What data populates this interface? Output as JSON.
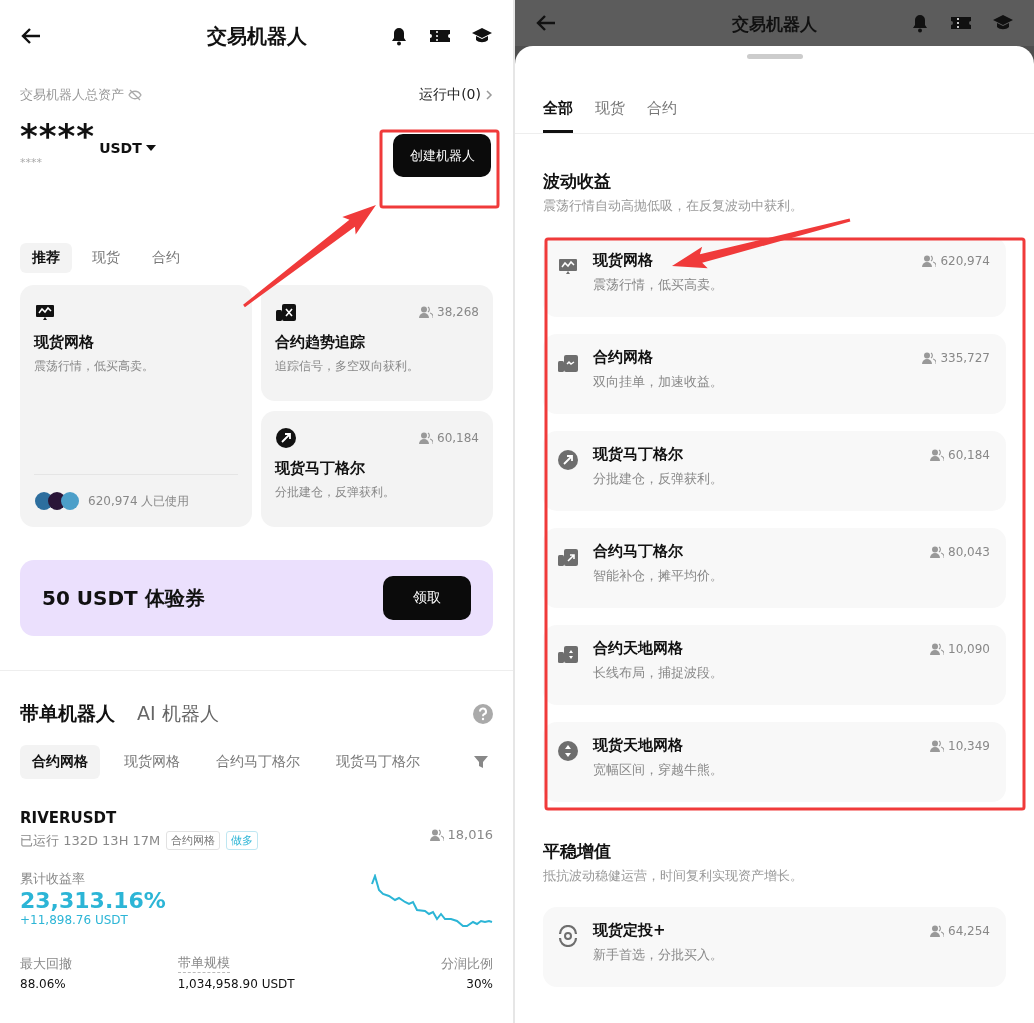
{
  "left": {
    "header": {
      "title": "交易机器人"
    },
    "assets": {
      "label": "交易机器人总资产",
      "running": "运行中(0)",
      "amount": "****",
      "currency": "USDT",
      "sub_amount": "****",
      "create_button": "创建机器人"
    },
    "tabs": [
      {
        "label": "推荐",
        "selected": true
      },
      {
        "label": "现货",
        "selected": false
      },
      {
        "label": "合约",
        "selected": false
      }
    ],
    "featured": {
      "title": "现货网格",
      "desc": "震荡行情，低买高卖。",
      "users": "620,974 人已使用",
      "kind": "grid"
    },
    "cards": [
      {
        "title": "合约趋势追踪",
        "desc": "追踪信号，多空双向获利。",
        "count": "38,268",
        "kind": "contract-cross"
      },
      {
        "title": "现货马丁格尔",
        "desc": "分批建仓，反弹获利。",
        "count": "60,184",
        "kind": "circle-arrow"
      }
    ],
    "promo": {
      "title": "50 USDT 体验券",
      "button": "领取"
    },
    "bot_tabs": [
      {
        "label": "带单机器人",
        "selected": true
      },
      {
        "label": "AI 机器人",
        "selected": false
      }
    ],
    "filters": [
      {
        "label": "合约网格",
        "selected": true
      },
      {
        "label": "现货网格",
        "selected": false
      },
      {
        "label": "合约马丁格尔",
        "selected": false
      },
      {
        "label": "现货马丁格尔",
        "selected": false
      }
    ],
    "bot": {
      "pair": "RIVERUSDT",
      "runtime": "已运行 132D 13H 17M",
      "tags": [
        {
          "label": "合约网格",
          "kind": "neutral"
        },
        {
          "label": "做多",
          "kind": "long"
        }
      ],
      "followers": "18,016",
      "return_label": "累计收益率",
      "return": "23,313.16%",
      "profit": "+11,898.76 USDT",
      "stats": [
        {
          "label": "最大回撤",
          "value": "88.06%",
          "dashed": false
        },
        {
          "label": "带单规模",
          "value": "1,034,958.90 USDT",
          "dashed": true
        },
        {
          "label": "分润比例",
          "value": "30%",
          "dashed": false
        }
      ]
    }
  },
  "right": {
    "background_title": "交易机器人",
    "tabs": [
      {
        "label": "全部",
        "selected": true
      },
      {
        "label": "现货",
        "selected": false
      },
      {
        "label": "合约",
        "selected": false
      }
    ],
    "sections": [
      {
        "title": "波动收益",
        "desc": "震荡行情自动高抛低吸，在反复波动中获利。",
        "items": [
          {
            "title": "现货网格",
            "desc": "震荡行情，低买高卖。",
            "count": "620,974",
            "kind": "grid"
          },
          {
            "title": "合约网格",
            "desc": "双向挂单，加速收益。",
            "count": "335,727",
            "kind": "contract-wave"
          },
          {
            "title": "现货马丁格尔",
            "desc": "分批建仓，反弹获利。",
            "count": "60,184",
            "kind": "circle-arrow"
          },
          {
            "title": "合约马丁格尔",
            "desc": "智能补仓，摊平均价。",
            "count": "80,043",
            "kind": "contract-arrow"
          },
          {
            "title": "合约天地网格",
            "desc": "长线布局，捕捉波段。",
            "count": "10,090",
            "kind": "contract-updown"
          },
          {
            "title": "现货天地网格",
            "desc": "宽幅区间，穿越牛熊。",
            "count": "10,349",
            "kind": "circle-updown"
          }
        ]
      },
      {
        "title": "平稳增值",
        "desc": "抵抗波动稳健运营，时间复利实现资产增长。",
        "items": [
          {
            "title": "现货定投+",
            "desc": "新手首选，分批买入。",
            "count": "64,254",
            "kind": "cycle"
          }
        ]
      }
    ]
  }
}
